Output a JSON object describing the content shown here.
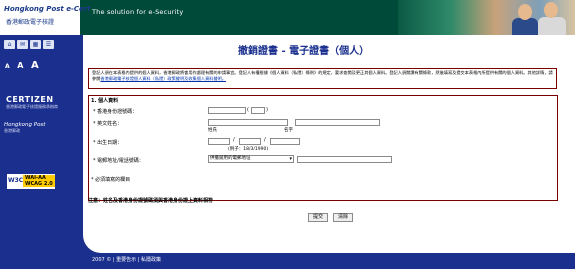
{
  "header": {
    "logo_line1": "Hongkong Post e-Cert",
    "logo_line2": "香港郵政電子核證",
    "tagline": "The solution for e-Security"
  },
  "sidebar": {
    "nav_buttons": [
      "⌂",
      "✉",
      "▦",
      "☰"
    ],
    "font_sizes": [
      "A",
      "A",
      "A"
    ],
    "certizen_name": "CERTIZEN",
    "certizen_sub": "香港郵政電子核證服務承辦商",
    "hkpost_name": "Hongkong Post",
    "hkpost_sub": "香港郵政",
    "wai_w3c": "W3C",
    "wai_text": "WAI-AA WCAG 2.0"
  },
  "page": {
    "title": "撤銷證書 - 電子證書（個人）",
    "notice_text": "登記人須在本表格內提供的個人資料，香港郵政將會用作處理有關的申請事宜。登記人有權根據《個人資料（私隱）條例》的規定，要求查閱及更正其個人資料。登記人須閱讀有關條款，然後填寫及提交本表格內所提供有關的個人資料。其他詳情，請參閱",
    "notice_link": "香港郵政電子核證個人資料（私隱）政策聲明及收集個人資料聲明。"
  },
  "form": {
    "section_title": "1. 個人資料",
    "hkid_label": "* 香港身份證號碼：",
    "hkid_paren_open": "(",
    "hkid_paren_close": ")",
    "name_label": "* 英文姓名：",
    "surname_label": "姓氏",
    "given_name_label": "名字",
    "dob_label": "* 出生日期：",
    "dob_sep1": "/",
    "dob_sep2": "/",
    "dob_example": "(例子：18/3/1990)",
    "contact_label": "* 電郵地址/電話號碼：",
    "contact_select_value": "供撤銷用的電郵地址",
    "required_note": "* 必須填寫的欄目"
  },
  "warning": "注意：姓名及香港身份證號碼須與香港身份證上資料相符",
  "buttons": {
    "submit": "提交",
    "clear": "清除"
  },
  "footer": {
    "text": "2007 © | 重要告示 | 私隱政策"
  },
  "colors": {
    "brand_blue": "#1a2f8e",
    "header_green": "#004a3a",
    "border_red": "#7a0000"
  }
}
